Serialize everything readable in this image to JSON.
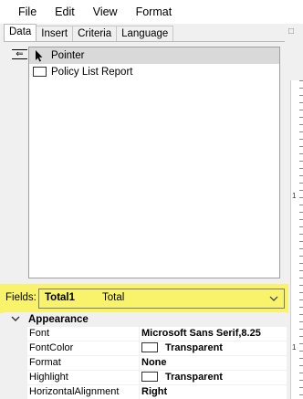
{
  "menu": [
    "File",
    "Edit",
    "View",
    "Format"
  ],
  "tabs": [
    "Data",
    "Insert",
    "Criteria",
    "Language"
  ],
  "tree": {
    "items": [
      {
        "label": "Pointer",
        "icon": "pointer-arrow-icon"
      },
      {
        "label": "Policy List Report",
        "icon": "document-icon"
      }
    ]
  },
  "ruler": {
    "top_label": "□",
    "marks": [
      "1",
      "1"
    ]
  },
  "fields": {
    "label": "Fields:",
    "selected_name": "Total1",
    "selected_type": "Total",
    "highlight_color": "#f9f36b"
  },
  "properties": {
    "category": "Appearance",
    "rows": [
      {
        "name": "Font",
        "value": "Microsoft Sans Serif,8.25"
      },
      {
        "name": "FontColor",
        "value": "Transparent"
      },
      {
        "name": "Format",
        "value": "None"
      },
      {
        "name": "Highlight",
        "value": "Transparent"
      },
      {
        "name": "HorizontalAlignment",
        "value": "Right"
      }
    ]
  }
}
